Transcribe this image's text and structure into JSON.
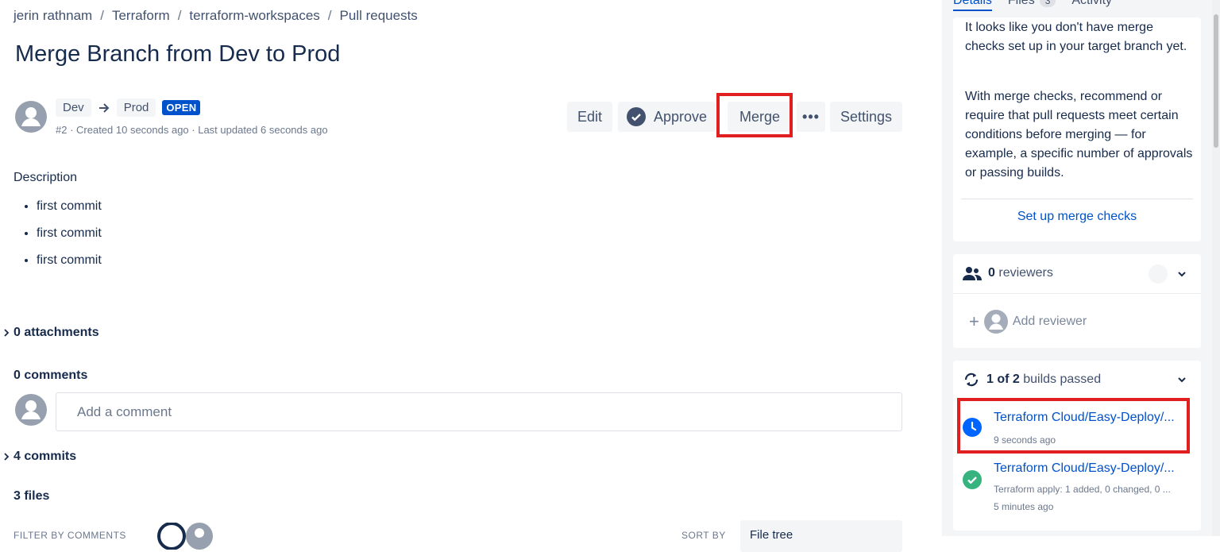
{
  "breadcrumb": [
    "jerin rathnam",
    "Terraform",
    "terraform-workspaces",
    "Pull requests"
  ],
  "breadcrumb_separator": "/",
  "title": "Merge Branch from Dev to Prod",
  "branches": {
    "source": "Dev",
    "target": "Prod",
    "status": "OPEN"
  },
  "meta": "#2 · Created 10 seconds ago · Last updated 6 seconds ago",
  "actions": {
    "edit": "Edit",
    "approve": "Approve",
    "merge": "Merge",
    "more": "•••",
    "settings": "Settings"
  },
  "description": {
    "label": "Description",
    "items": [
      "first commit",
      "first commit",
      "first commit"
    ]
  },
  "attachments": "0 attachments",
  "comments": {
    "label": "0 comments",
    "placeholder": "Add a comment"
  },
  "commits": "4 commits",
  "files": "3 files",
  "footer": {
    "filter_label": "FILTER BY COMMENTS",
    "sort_label": "SORT BY",
    "sort_value": "File tree"
  },
  "sidebar": {
    "tabs": [
      {
        "label": "Details",
        "active": true
      },
      {
        "label": "Files",
        "badge": "3"
      },
      {
        "label": "Activity"
      }
    ],
    "merge_checks": {
      "text1": "It looks like you don't have merge checks set up in your target branch yet.",
      "text2": "With merge checks, recommend or require that pull requests meet certain conditions before merging — for example, a specific number of approvals or passing builds.",
      "link": "Set up merge checks"
    },
    "reviewers": {
      "count": "0",
      "label": "reviewers",
      "add_label": "Add reviewer"
    },
    "builds": {
      "count": "1 of 2",
      "label": "builds passed",
      "items": [
        {
          "title": "Terraform Cloud/Easy-Deploy/...",
          "time": "9 seconds ago",
          "status": "in-progress"
        },
        {
          "title": "Terraform Cloud/Easy-Deploy/...",
          "subtitle": "Terraform apply: 1 added, 0 changed, 0 ...",
          "time": "5 minutes ago",
          "status": "success"
        }
      ]
    }
  },
  "colors": {
    "link": "#0052cc",
    "highlight": "#e02020",
    "success": "#36b37e",
    "lozenge": "#0052cc"
  }
}
